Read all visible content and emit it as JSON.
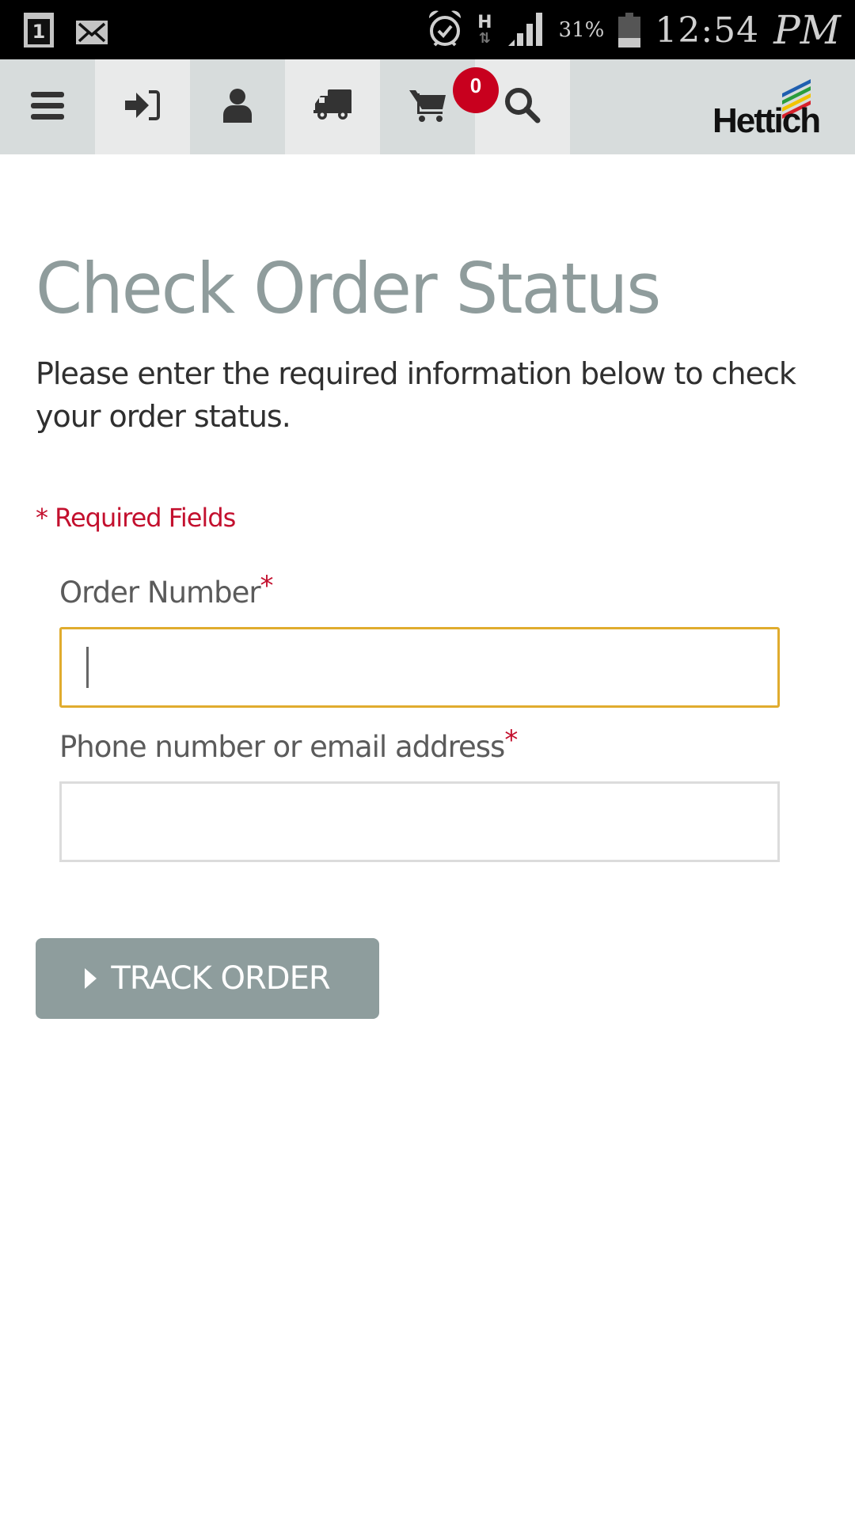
{
  "status_bar": {
    "notification_count": "1",
    "network_type": "H",
    "network_arrows": "⇅",
    "battery_percent": "31%",
    "battery_level": 0.31,
    "time": "12:54",
    "ampm": "PM"
  },
  "nav": {
    "items": [
      {
        "name": "menu",
        "icon": "hamburger-icon"
      },
      {
        "name": "login",
        "icon": "sign-in-icon"
      },
      {
        "name": "account",
        "icon": "user-icon"
      },
      {
        "name": "order-tracking",
        "icon": "truck-icon"
      },
      {
        "name": "cart",
        "icon": "cart-icon"
      },
      {
        "name": "search",
        "icon": "search-icon"
      }
    ],
    "cart_count": "0",
    "logo_text": "Hettich",
    "logo_stripe_colors": [
      "#1f5fb0",
      "#2a9d3c",
      "#f2c300",
      "#d7212b"
    ]
  },
  "page": {
    "title": "Check Order Status",
    "intro": "Please enter the required information below to check your order status.",
    "required_note": "* Required Fields",
    "fields": [
      {
        "label": "Order Number",
        "required_mark": "*",
        "value": "",
        "placeholder": "",
        "focused": true
      },
      {
        "label": "Phone number or email address",
        "required_mark": "*",
        "value": "",
        "placeholder": "",
        "focused": false
      }
    ],
    "submit_label": "TRACK ORDER"
  },
  "colors": {
    "accent_red": "#c3102e",
    "title_gray": "#8f9c9c",
    "button_gray": "#8e9d9d",
    "focus_border": "#e0ac2e"
  }
}
